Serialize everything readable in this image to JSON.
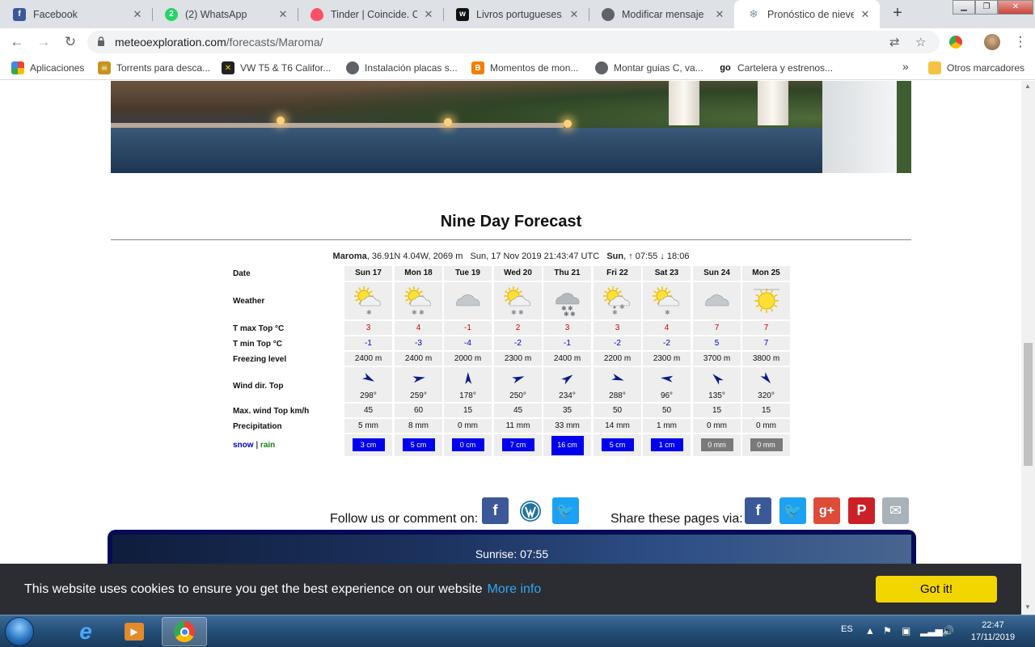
{
  "tabs": [
    {
      "title": "Facebook",
      "icon": "facebook-icon",
      "color": "#3b5998",
      "active": false
    },
    {
      "title": "(2) WhatsApp",
      "icon": "whatsapp-icon",
      "color": "#25d366",
      "active": false
    },
    {
      "title": "Tinder | Coincide. Cha",
      "icon": "tinder-icon",
      "color": "#fd5068",
      "active": false
    },
    {
      "title": "Livros portugueses, liv",
      "icon": "wattpad-icon",
      "color": "#111111",
      "active": false
    },
    {
      "title": "Modificar mensaje",
      "icon": "globe-icon",
      "color": "#5f6368",
      "active": false
    },
    {
      "title": "Pronóstico de nieve y",
      "icon": "snowflake-icon",
      "color": "#8899aa",
      "active": true
    }
  ],
  "omnibox": {
    "host": "meteoexploration.com",
    "path": "/forecasts/Maroma/"
  },
  "bookmarks": [
    {
      "label": "Aplicaciones",
      "icon": "apps-grid-icon"
    },
    {
      "label": "Torrents para desca...",
      "icon": "torrent-icon"
    },
    {
      "label": "VW T5 & T6 Califor...",
      "icon": "vw-icon"
    },
    {
      "label": "Instalación placas s...",
      "icon": "globe-icon"
    },
    {
      "label": "Momentos de mon...",
      "icon": "blogger-icon"
    },
    {
      "label": "Montar guias C, va...",
      "icon": "globe-icon"
    },
    {
      "label": "Cartelera y estrenos...",
      "icon": "go-icon"
    },
    {
      "label": "»",
      "icon": "chevron-more-icon"
    },
    {
      "label": "Otros marcadores",
      "icon": "folder-icon"
    }
  ],
  "page": {
    "title": "Nine Day Forecast",
    "location": {
      "name": "Maroma",
      "coords": ", 36.91N 4.04W, 2069 m",
      "datetime": "Sun, 17 Nov 2019 21:43:47 UTC",
      "sun_label": "Sun",
      "sun_times": ", ↑ 07:55 ↓ 18:06"
    },
    "row_labels": {
      "date": "Date",
      "weather": "Weather",
      "tmax": "T max Top °C",
      "tmin": "T min Top °C",
      "freezing": "Freezing level",
      "wind_dir": "Wind dir. Top",
      "wind_max": "Max. wind Top km/h",
      "precip": "Precipitation",
      "snow": "snow",
      "sep": " | ",
      "rain": "rain"
    },
    "days": [
      {
        "date": "Sun 17",
        "weather": "sun-cloud-snow",
        "tmax": "3",
        "tmin": "-1",
        "freezing": "2400 m",
        "wind_deg": 298,
        "wind": "298°",
        "wind_max": "45",
        "precip": "5 mm",
        "snow": "3 cm",
        "snow_kind": "snow"
      },
      {
        "date": "Mon 18",
        "weather": "sun-cloud-snow2",
        "tmax": "4",
        "tmin": "-3",
        "freezing": "2400 m",
        "wind_deg": 259,
        "wind": "259°",
        "wind_max": "60",
        "precip": "8 mm",
        "snow": "5 cm",
        "snow_kind": "snow"
      },
      {
        "date": "Tue 19",
        "weather": "cloud",
        "tmax": "-1",
        "tmin": "-4",
        "freezing": "2000 m",
        "wind_deg": 178,
        "wind": "178°",
        "wind_max": "15",
        "precip": "0 mm",
        "snow": "0 cm",
        "snow_kind": "snow"
      },
      {
        "date": "Wed 20",
        "weather": "sun-cloud-snow2",
        "tmax": "2",
        "tmin": "-2",
        "freezing": "2300 m",
        "wind_deg": 250,
        "wind": "250°",
        "wind_max": "45",
        "precip": "11 mm",
        "snow": "7 cm",
        "snow_kind": "snow"
      },
      {
        "date": "Thu 21",
        "weather": "cloud-heavy-snow",
        "tmax": "3",
        "tmin": "-1",
        "freezing": "2400 m",
        "wind_deg": 234,
        "wind": "234°",
        "wind_max": "35",
        "precip": "33 mm",
        "snow": "16 cm",
        "snow_kind": "snow"
      },
      {
        "date": "Fri 22",
        "weather": "sun-cloud-snow-rain",
        "tmax": "3",
        "tmin": "-2",
        "freezing": "2200 m",
        "wind_deg": 288,
        "wind": "288°",
        "wind_max": "50",
        "precip": "14 mm",
        "snow": "5 cm",
        "snow_kind": "snow"
      },
      {
        "date": "Sat 23",
        "weather": "sun-cloud-snow",
        "tmax": "4",
        "tmin": "-2",
        "freezing": "2300 m",
        "wind_deg": 96,
        "wind": "96°",
        "wind_max": "50",
        "precip": "1 mm",
        "snow": "1 cm",
        "snow_kind": "snow"
      },
      {
        "date": "Sun 24",
        "weather": "cloud",
        "tmax": "7",
        "tmin": "5",
        "freezing": "3700 m",
        "wind_deg": 135,
        "wind": "135°",
        "wind_max": "15",
        "precip": "0 mm",
        "snow": "0 mm",
        "snow_kind": "rain"
      },
      {
        "date": "Mon 25",
        "weather": "sun",
        "tmax": "7",
        "tmin": "7",
        "freezing": "3800 m",
        "wind_deg": 320,
        "wind": "320°",
        "wind_max": "15",
        "precip": "0 mm",
        "snow": "0 mm",
        "snow_kind": "rain"
      }
    ],
    "follow_label": "Follow us or comment on:",
    "share_label": "Share these pages via:",
    "sunrise": "Sunrise: 07:55"
  },
  "cookie": {
    "message": "This website uses cookies to ensure you get the best experience on our website",
    "more": "More info",
    "button": "Got it!"
  },
  "taskbar": {
    "lang": "ES",
    "time": "22:47",
    "date": "17/11/2019"
  },
  "colors": {
    "snow_blue": "#0000ee",
    "rain_grey": "#7a7a7a",
    "tmax_red": "#d00000",
    "tmin_blue": "#0000cc",
    "cookie_bg": "#2b2d33",
    "cookie_btn": "#f1d600"
  }
}
